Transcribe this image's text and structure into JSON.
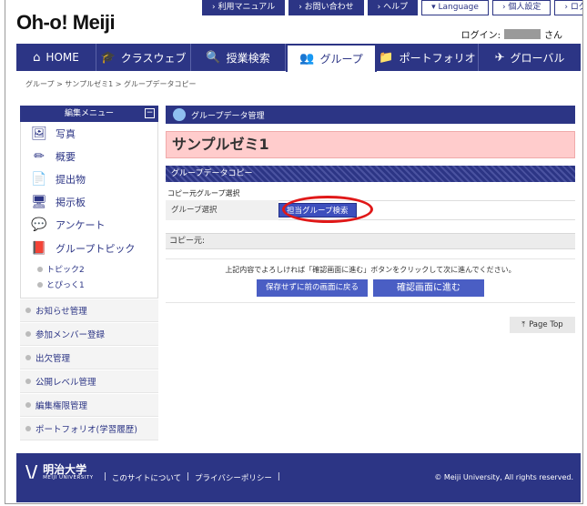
{
  "app": {
    "logo": "Oh-o! Meiji"
  },
  "util_nav": [
    {
      "label": "› 利用マニュアル"
    },
    {
      "label": "› お問い合わせ"
    },
    {
      "label": "› ヘルプ"
    },
    {
      "label": "▾ Language"
    },
    {
      "label": "› 個人設定"
    },
    {
      "label": "› ログアウト"
    }
  ],
  "login": {
    "prefix": "ログイン:",
    "suffix": "さん"
  },
  "global_nav": [
    {
      "label": "HOME",
      "icon": "home-icon",
      "glyph": "⌂"
    },
    {
      "label": "クラスウェブ",
      "icon": "graduation-cap-icon",
      "glyph": "🎓"
    },
    {
      "label": "授業検索",
      "icon": "search-icon",
      "glyph": "🔍"
    },
    {
      "label": "グループ",
      "icon": "group-icon",
      "glyph": "👥"
    },
    {
      "label": "ポートフォリオ",
      "icon": "folder-icon",
      "glyph": "📁"
    },
    {
      "label": "グローバル",
      "icon": "airplane-icon",
      "glyph": "✈"
    }
  ],
  "breadcrumb": "グループ  >  サンプルゼミ1  >  グループデータコピー",
  "sidebar": {
    "title": "編集メニュー",
    "items": [
      {
        "label": "写真",
        "icon": "photo-icon",
        "glyph": "🖼"
      },
      {
        "label": "概要",
        "icon": "pencil-icon",
        "glyph": "✏"
      },
      {
        "label": "提出物",
        "icon": "document-icon",
        "glyph": "📄"
      },
      {
        "label": "掲示板",
        "icon": "monitor-icon",
        "glyph": "🖥"
      },
      {
        "label": "アンケート",
        "icon": "qa-icon",
        "glyph": "💬"
      },
      {
        "label": "グループトピック",
        "icon": "topic-icon",
        "glyph": "📕"
      }
    ],
    "sub_items": [
      {
        "label": "トピック2"
      },
      {
        "label": "とぴっく1"
      }
    ],
    "links": [
      {
        "label": "お知らせ管理"
      },
      {
        "label": "参加メンバー登録"
      },
      {
        "label": "出欠管理"
      },
      {
        "label": "公開レベル管理"
      },
      {
        "label": "編集権限管理"
      },
      {
        "label": "ポートフォリオ(学習履歴)"
      }
    ]
  },
  "main": {
    "panel_title": "グループデータ管理",
    "group_name": "サンプルゼミ1",
    "section_title": "グループデータコピー",
    "source_label": "コピー元グループ選択",
    "group_select_label": "グループ選択",
    "search_button": "担当グループ検索",
    "copy_to_label": "コピー元:",
    "message": "上記内容でよろしければ「確認画面に進む」ボタンをクリックして次に進んでください。",
    "back_button": "保存せずに前の画面に戻る",
    "confirm_button": "確認画面に進む",
    "page_top": "Page Top"
  },
  "footer": {
    "logo_jp": "明治大学",
    "logo_en": "MEIJI UNIVERSITY",
    "links": [
      "|",
      "このサイトについて",
      "|",
      "プライバシーポリシー",
      "|"
    ],
    "copyright": "© Meiji University, All rights reserved."
  },
  "colors": {
    "brand": "#2c3585",
    "title_bg": "#ffcccc",
    "highlight": "#e01818"
  }
}
